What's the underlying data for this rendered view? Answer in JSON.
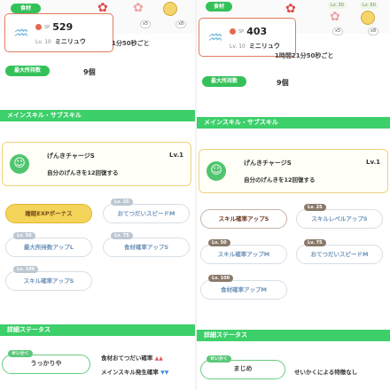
{
  "left": {
    "ingredient_pill": "食材",
    "card": {
      "sp_label": "SP",
      "sp_value": "529",
      "lv_label": "Lv. 10",
      "name": "ミニリュウ"
    },
    "badge_1": "x5",
    "badge_2": "x8",
    "behind_text": "1分50秒ごと",
    "max_carry_label": "最大所持数",
    "max_carry_value": "9個",
    "main_skill_section": "メインスキル・サブスキル",
    "skill": {
      "name": "げんきチャージS",
      "lv": "Lv.1",
      "desc": "自分のげんきを12回復する"
    },
    "subskills": [
      {
        "label": "睡眠EXPボーナス",
        "tag": ""
      },
      {
        "label": "おてつだいスピードM",
        "tag": "Lv. 25"
      },
      {
        "label": "最大所持数アップL",
        "tag": "Lv. 50"
      },
      {
        "label": "食材確率アップS",
        "tag": "Lv. 75"
      },
      {
        "label": "スキル確率アップS",
        "tag": "Lv. 100"
      }
    ],
    "detail_section": "詳細ステータス",
    "nature_tag": "せいかく",
    "nature": "うっかりや",
    "nature_up": "食材おてつだい確率",
    "nature_up_marks": "▲▲",
    "nature_down": "メインスキル発生確率",
    "nature_down_marks": "▼▼"
  },
  "right": {
    "ingredient_pill": "食材",
    "card": {
      "sp_label": "SP",
      "sp_value": "403",
      "lv_label": "Lv. 10",
      "name": "ミニリュウ"
    },
    "top_lv_1": "Lv. 30",
    "top_lv_2": "Lv. 60",
    "badge_1": "x5",
    "badge_2": "x8",
    "behind_text": "1時間21分50秒ごと",
    "max_carry_label": "最大所持数",
    "max_carry_value": "9個",
    "main_skill_section": "メインスキル・サブスキル",
    "skill": {
      "name": "げんきチャージS",
      "lv": "Lv.1",
      "desc": "自分のげんきを12回復する"
    },
    "subskills": [
      {
        "label": "スキル確率アップS",
        "tag": ""
      },
      {
        "label": "スキルレベルアップS",
        "tag": "Lv. 25"
      },
      {
        "label": "スキル確率アップM",
        "tag": "Lv. 50"
      },
      {
        "label": "おてつだいスピードM",
        "tag": "Lv. 75"
      },
      {
        "label": "食材確率アップM",
        "tag": "Lv. 100"
      }
    ],
    "detail_section": "詳細ステータス",
    "nature_tag": "せいかく",
    "nature": "まじめ",
    "nature_note": "せいかくによる特徴なし"
  }
}
